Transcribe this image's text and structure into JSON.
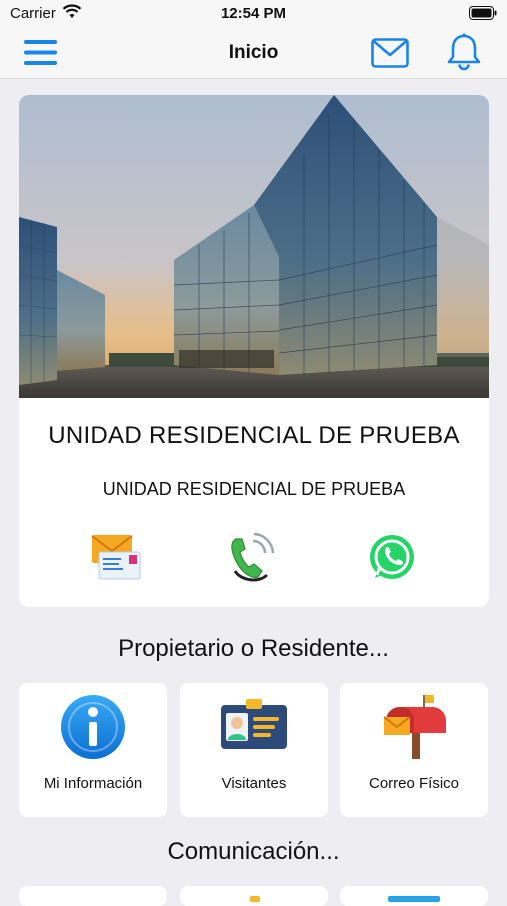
{
  "status_bar": {
    "carrier": "Carrier",
    "time": "12:54 PM"
  },
  "nav": {
    "title": "Inicio"
  },
  "hero": {
    "title": "UNIDAD RESIDENCIAL DE PRUEBA",
    "subtitle": "UNIDAD RESIDENCIAL DE PRUEBA",
    "contacts": [
      "email-icon",
      "phone-icon",
      "whatsapp-icon"
    ]
  },
  "sections": [
    {
      "heading": "Propietario o Residente...",
      "items": [
        {
          "label": "Mi Información",
          "icon": "info-icon"
        },
        {
          "label": "Visitantes",
          "icon": "visitor-badge-icon"
        },
        {
          "label": "Correo Físico",
          "icon": "mailbox-icon"
        }
      ]
    },
    {
      "heading": "Comunicación..."
    }
  ],
  "colors": {
    "accent": "#1a84e8",
    "background": "#eeeef2",
    "card": "#ffffff",
    "whatsapp": "#25d366"
  }
}
